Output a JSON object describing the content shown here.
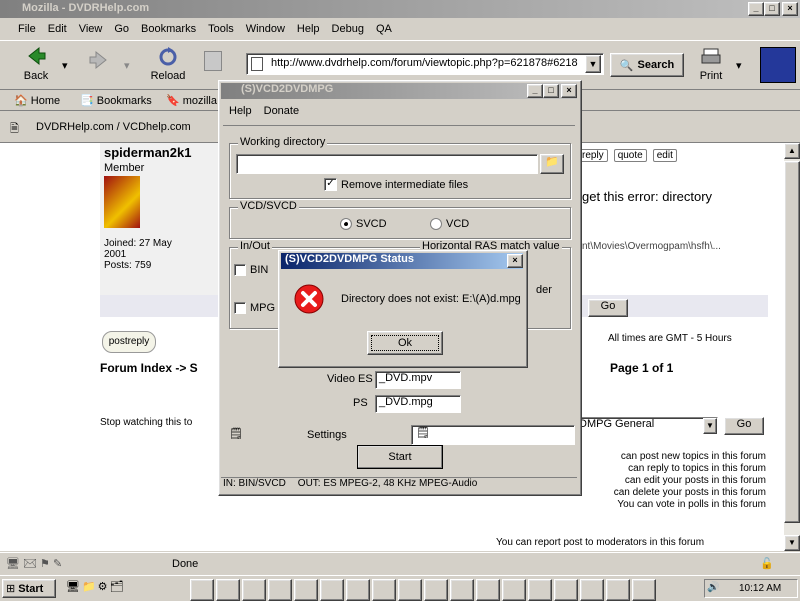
{
  "browser": {
    "title": "Mozilla - DVDRHelp.com",
    "menu": [
      "File",
      "Edit",
      "View",
      "Go",
      "Bookmarks",
      "Tools",
      "Window",
      "Help",
      "Debug",
      "QA"
    ],
    "toolbar": {
      "back": "Back",
      "reload": "Reload",
      "print": "Print",
      "search": "Search"
    },
    "url": "http://www.dvdrhelp.com/forum/viewtopic.php?p=621878#6218",
    "personal_bar": [
      "Home",
      "Bookmarks",
      "mozilla.org"
    ],
    "tab_label": "DVDRHelp.com / VCDhelp.com",
    "status": "Done"
  },
  "forum": {
    "username": "spiderman2k1",
    "rank": "Member",
    "joined": "Joined: 27 May 2001",
    "posts": "Posts: 759",
    "post_buttons": [
      "reply",
      "quote",
      "edit"
    ],
    "body_line1": "get this error: directory",
    "body_line2": "nt\\Movies\\Overmogpam\\hsfh\\...",
    "go_label": "Go",
    "timezone": "All times are GMT - 5 Hours",
    "postreply_label": "postreply",
    "breadcrumb": "Forum Index -> S",
    "page_info": "Page 1 of 1",
    "watching": "Stop watching this to",
    "jump_select": "DMPG General",
    "permissions": [
      "can post new topics in this forum",
      "can reply to topics in this forum",
      "can edit your posts in this forum",
      "can delete your posts in this forum",
      "You can vote in polls in this forum"
    ],
    "report": "You can report post to moderators in this forum"
  },
  "app": {
    "title": "(S)VCD2DVDMPG",
    "menu": [
      "Help",
      "Donate"
    ],
    "working_dir_label": "Working directory",
    "working_dir_value": "",
    "remove_intermediate": "Remove intermediate files",
    "remove_checked": true,
    "vcd_svcd_label": "VCD/SVCD",
    "opt_svcd": "SVCD",
    "opt_vcd": "VCD",
    "opt_selected": "svcd",
    "inout_label": "In/Out",
    "horiz_label": "Horizontal RAS match value",
    "bin_label": "BIN",
    "mpg_label": "MPG",
    "der_label": "der",
    "video_es_label": "Video ES",
    "video_es_value": "_DVD.mpv",
    "ps_label": "PS",
    "ps_value": "_DVD.mpg",
    "settings_label": "Settings",
    "start_label": "Start",
    "status_in": "IN: BIN/SVCD",
    "status_out": "OUT: ES MPEG-2, 48 KHz MPEG-Audio"
  },
  "dialog": {
    "title": "(S)VCD2DVDMPG Status",
    "message": "Directory does not exist: E:\\(A)d.mpg",
    "ok_label": "Ok"
  },
  "taskbar": {
    "start_label": "Start",
    "clock": "10:12 AM"
  },
  "colors": {
    "titlebar_active": "#0a246a",
    "error_red": "#e81c1c",
    "link_blue": "#00008b"
  }
}
